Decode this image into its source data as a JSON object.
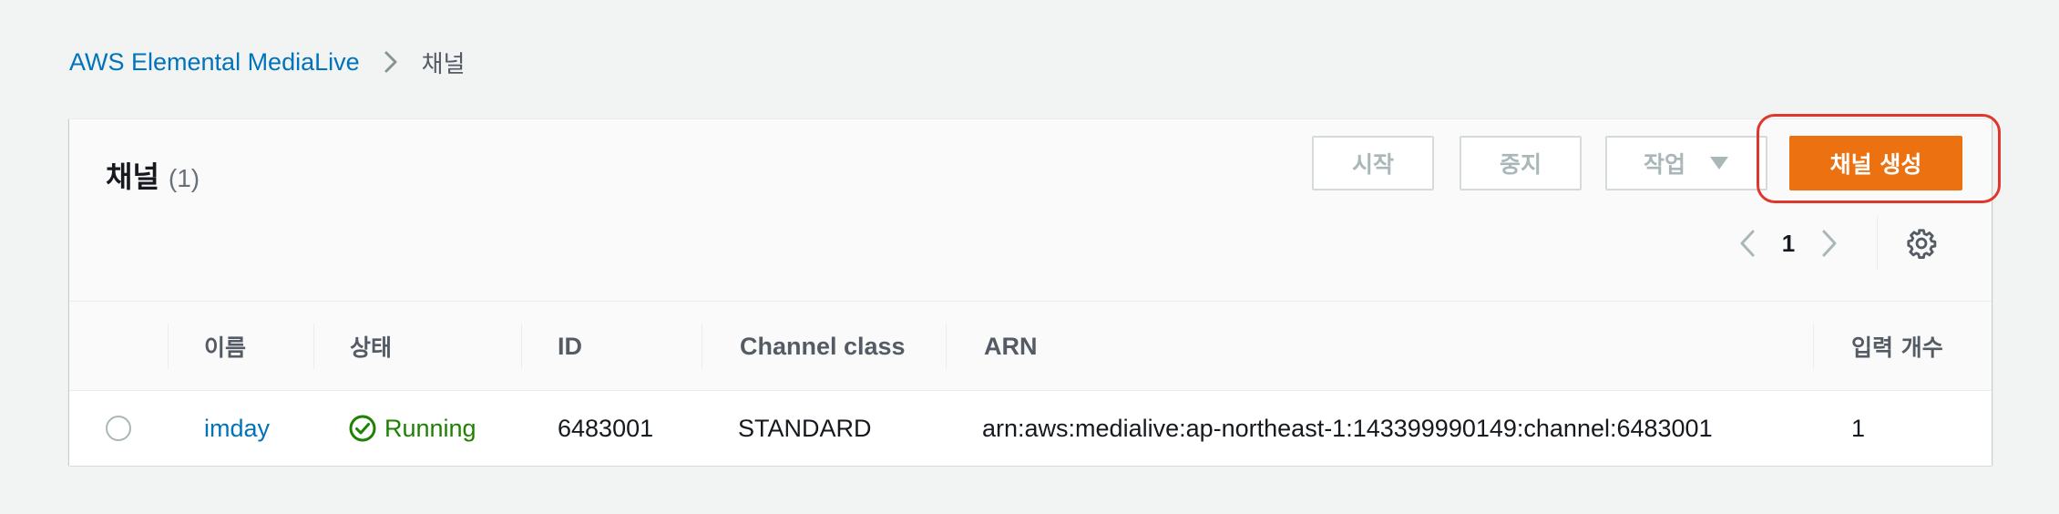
{
  "breadcrumb": {
    "root": "AWS Elemental MediaLive",
    "current": "채널"
  },
  "panel": {
    "title": "채널",
    "count": "(1)"
  },
  "actions": {
    "start": "시작",
    "stop": "중지",
    "actions": "작업",
    "create": "채널 생성"
  },
  "pagination": {
    "page": "1"
  },
  "table": {
    "columns": [
      "이름",
      "상태",
      "ID",
      "Channel class",
      "ARN",
      "입력 개수"
    ],
    "rows": [
      {
        "name": "imday",
        "status": "Running",
        "id": "6483001",
        "channel_class": "STANDARD",
        "arn": "arn:aws:medialive:ap-northeast-1:143399990149:channel:6483001",
        "input_count": "1"
      }
    ]
  },
  "colors": {
    "accent": "#ec7211",
    "link": "#0073bb",
    "success": "#1d8102",
    "highlight": "#e0372c"
  },
  "icons": {
    "breadcrumb_separator": "chevron-right-icon",
    "actions_caret": "caret-down-icon",
    "prev_page": "chevron-left-icon",
    "next_page": "chevron-right-icon",
    "settings": "gear-icon",
    "status": "check-circle-icon"
  }
}
